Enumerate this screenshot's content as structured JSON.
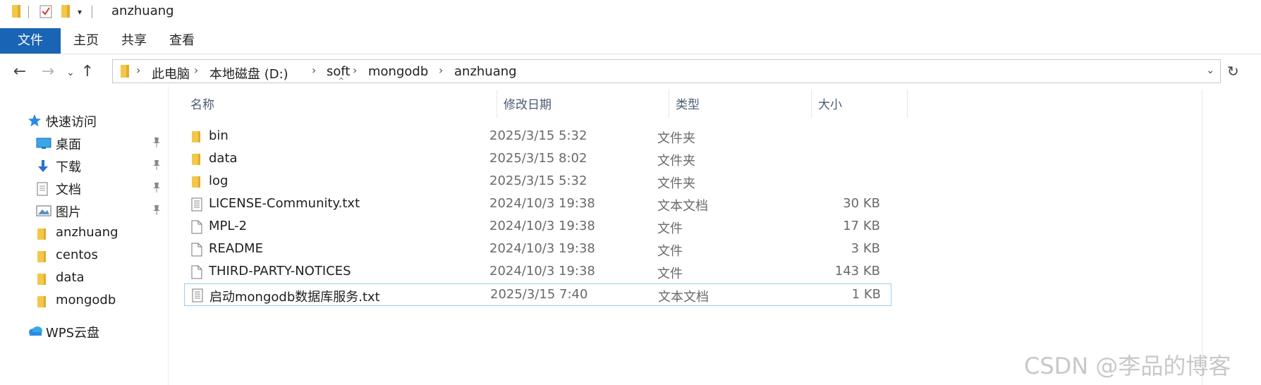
{
  "window": {
    "title": "anzhuang"
  },
  "ribbon": {
    "tabs": [
      "文件",
      "主页",
      "共享",
      "查看"
    ]
  },
  "address": {
    "crumbs": [
      "此电脑",
      "本地磁盘 (D:)",
      "soft",
      "mongodb",
      "anzhuang"
    ]
  },
  "nav": {
    "quick_access": "快速访问",
    "items": [
      {
        "label": "桌面",
        "icon": "desktop-icon",
        "pinned": true
      },
      {
        "label": "下载",
        "icon": "download-arrow-icon",
        "pinned": true
      },
      {
        "label": "文档",
        "icon": "document-icon",
        "pinned": true
      },
      {
        "label": "图片",
        "icon": "picture-icon",
        "pinned": true
      },
      {
        "label": "anzhuang",
        "icon": "folder-icon",
        "pinned": false
      },
      {
        "label": "centos",
        "icon": "folder-icon",
        "pinned": false
      },
      {
        "label": "data",
        "icon": "folder-icon",
        "pinned": false
      },
      {
        "label": "mongodb",
        "icon": "folder-icon",
        "pinned": false
      }
    ],
    "wps": "WPS云盘"
  },
  "list": {
    "columns": [
      "名称",
      "修改日期",
      "类型",
      "大小"
    ],
    "rows": [
      {
        "name": "bin",
        "date": "2025/3/15 5:32",
        "type": "文件夹",
        "size": "",
        "icon": "folder"
      },
      {
        "name": "data",
        "date": "2025/3/15 8:02",
        "type": "文件夹",
        "size": "",
        "icon": "folder"
      },
      {
        "name": "log",
        "date": "2025/3/15 5:32",
        "type": "文件夹",
        "size": "",
        "icon": "folder"
      },
      {
        "name": "LICENSE-Community.txt",
        "date": "2024/10/3 19:38",
        "type": "文本文档",
        "size": "30 KB",
        "icon": "text-file"
      },
      {
        "name": "MPL-2",
        "date": "2024/10/3 19:38",
        "type": "文件",
        "size": "17 KB",
        "icon": "file"
      },
      {
        "name": "README",
        "date": "2024/10/3 19:38",
        "type": "文件",
        "size": "3 KB",
        "icon": "file"
      },
      {
        "name": "THIRD-PARTY-NOTICES",
        "date": "2024/10/3 19:38",
        "type": "文件",
        "size": "143 KB",
        "icon": "file"
      },
      {
        "name": "启动mongodb数据库服务.txt",
        "date": "2025/3/15 7:40",
        "type": "文本文档",
        "size": "1 KB",
        "icon": "text-file",
        "selected": true
      }
    ]
  },
  "watermark": "CSDN @李品的博客",
  "colors": {
    "ribbon_file_tab": "#1964b4",
    "selection_border": "#99cff3",
    "folder": "#f2c84b"
  }
}
